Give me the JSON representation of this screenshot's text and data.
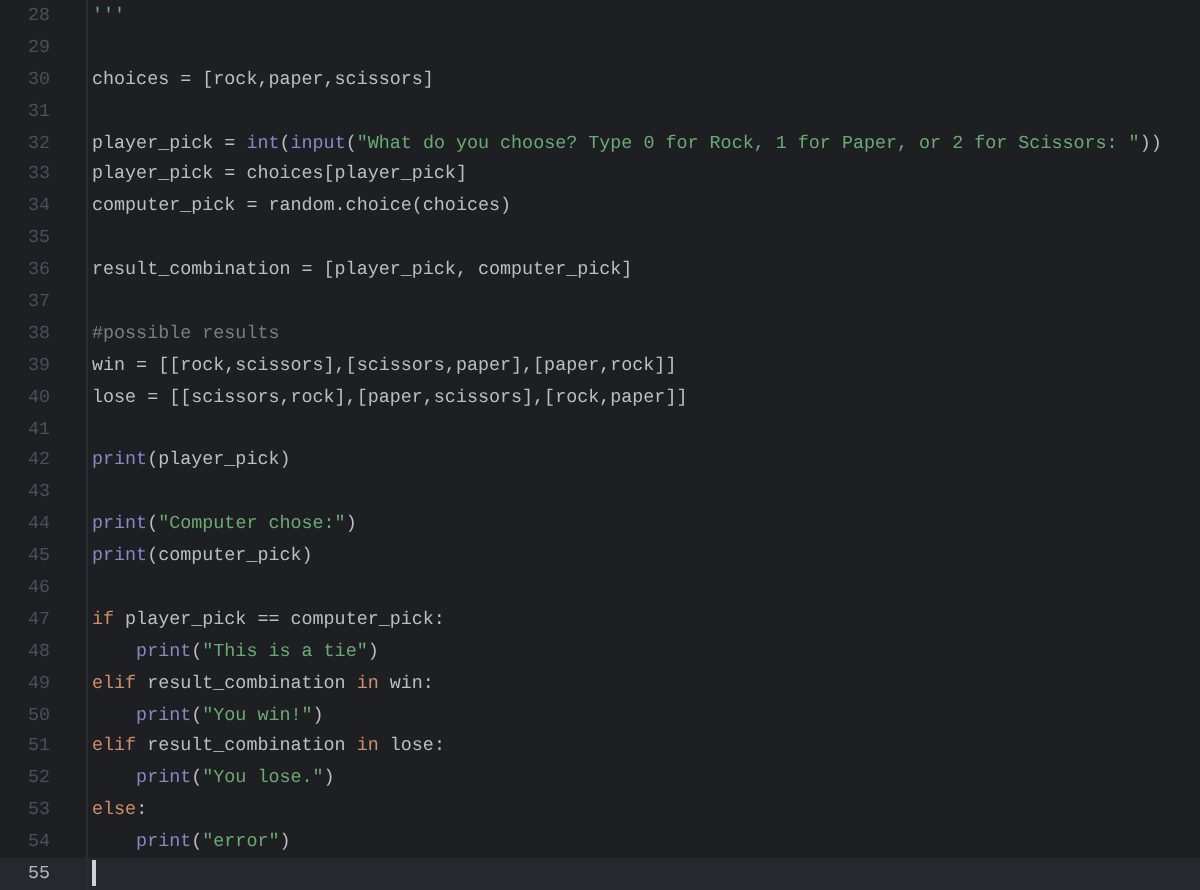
{
  "editor": {
    "lines": [
      {
        "number": "28",
        "current": false,
        "tokens": [
          {
            "kind": "string",
            "text": "'''"
          }
        ]
      },
      {
        "number": "29",
        "current": false
      },
      {
        "number": "30",
        "current": false,
        "tokens": [
          {
            "kind": "plain",
            "text": "choices = [rock,paper,scissors]"
          }
        ]
      },
      {
        "number": "31",
        "current": false
      },
      {
        "number": "32",
        "current": false,
        "tokens": [
          {
            "kind": "plain",
            "text": "player_pick = "
          },
          {
            "kind": "builtin",
            "text": "int"
          },
          {
            "kind": "plain",
            "text": "("
          },
          {
            "kind": "builtin",
            "text": "input"
          },
          {
            "kind": "plain",
            "text": "("
          },
          {
            "kind": "string",
            "text": "\"What do you choose? Type 0 for Rock, 1 for Paper, or 2 for Scissors: \""
          },
          {
            "kind": "plain",
            "text": "))"
          }
        ]
      },
      {
        "number": "33",
        "current": false,
        "tokens": [
          {
            "kind": "plain",
            "text": "player_pick = choices[player_pick]"
          }
        ]
      },
      {
        "number": "34",
        "current": false,
        "tokens": [
          {
            "kind": "plain",
            "text": "computer_pick = random.choice(choices)"
          }
        ]
      },
      {
        "number": "35",
        "current": false
      },
      {
        "number": "36",
        "current": false,
        "tokens": [
          {
            "kind": "plain",
            "text": "result_combination = [player_pick, computer_pick]"
          }
        ]
      },
      {
        "number": "37",
        "current": false
      },
      {
        "number": "38",
        "current": false,
        "tokens": [
          {
            "kind": "comment",
            "text": "#possible results"
          }
        ]
      },
      {
        "number": "39",
        "current": false,
        "tokens": [
          {
            "kind": "plain",
            "text": "win = [[rock,scissors],[scissors,paper],[paper,rock]]"
          }
        ]
      },
      {
        "number": "40",
        "current": false,
        "tokens": [
          {
            "kind": "plain",
            "text": "lose = [[scissors,rock],[paper,scissors],[rock,paper]]"
          }
        ]
      },
      {
        "number": "41",
        "current": false
      },
      {
        "number": "42",
        "current": false,
        "tokens": [
          {
            "kind": "builtin",
            "text": "print"
          },
          {
            "kind": "plain",
            "text": "(player_pick)"
          }
        ]
      },
      {
        "number": "43",
        "current": false
      },
      {
        "number": "44",
        "current": false,
        "tokens": [
          {
            "kind": "builtin",
            "text": "print"
          },
          {
            "kind": "plain",
            "text": "("
          },
          {
            "kind": "string",
            "text": "\"Computer chose:\""
          },
          {
            "kind": "plain",
            "text": ")"
          }
        ]
      },
      {
        "number": "45",
        "current": false,
        "tokens": [
          {
            "kind": "builtin",
            "text": "print"
          },
          {
            "kind": "plain",
            "text": "(computer_pick)"
          }
        ]
      },
      {
        "number": "46",
        "current": false
      },
      {
        "number": "47",
        "current": false,
        "tokens": [
          {
            "kind": "keyword",
            "text": "if"
          },
          {
            "kind": "plain",
            "text": " player_pick == computer_pick:"
          }
        ]
      },
      {
        "number": "48",
        "current": false,
        "tokens": [
          {
            "kind": "builtin",
            "text": "    print"
          },
          {
            "kind": "plain",
            "text": "("
          },
          {
            "kind": "string",
            "text": "\"This is a tie\""
          },
          {
            "kind": "plain",
            "text": ")"
          }
        ]
      },
      {
        "number": "49",
        "current": false,
        "tokens": [
          {
            "kind": "keyword",
            "text": "elif"
          },
          {
            "kind": "plain",
            "text": " result_combination "
          },
          {
            "kind": "keyword",
            "text": "in"
          },
          {
            "kind": "plain",
            "text": " win:"
          }
        ]
      },
      {
        "number": "50",
        "current": false,
        "tokens": [
          {
            "kind": "builtin",
            "text": "    print"
          },
          {
            "kind": "plain",
            "text": "("
          },
          {
            "kind": "string",
            "text": "\"You win!\""
          },
          {
            "kind": "plain",
            "text": ")"
          }
        ]
      },
      {
        "number": "51",
        "current": false,
        "tokens": [
          {
            "kind": "keyword",
            "text": "elif"
          },
          {
            "kind": "plain",
            "text": " result_combination "
          },
          {
            "kind": "keyword",
            "text": "in"
          },
          {
            "kind": "plain",
            "text": " lose:"
          }
        ]
      },
      {
        "number": "52",
        "current": false,
        "tokens": [
          {
            "kind": "builtin",
            "text": "    print"
          },
          {
            "kind": "plain",
            "text": "("
          },
          {
            "kind": "string",
            "text": "\"You lose.\""
          },
          {
            "kind": "plain",
            "text": ")"
          }
        ]
      },
      {
        "number": "53",
        "current": false,
        "tokens": [
          {
            "kind": "keyword",
            "text": "else"
          },
          {
            "kind": "plain",
            "text": ":"
          }
        ]
      },
      {
        "number": "54",
        "current": false,
        "tokens": [
          {
            "kind": "builtin",
            "text": "    print"
          },
          {
            "kind": "plain",
            "text": "("
          },
          {
            "kind": "string",
            "text": "\"error\""
          },
          {
            "kind": "plain",
            "text": ")"
          }
        ]
      },
      {
        "number": "55",
        "current": true
      }
    ]
  }
}
